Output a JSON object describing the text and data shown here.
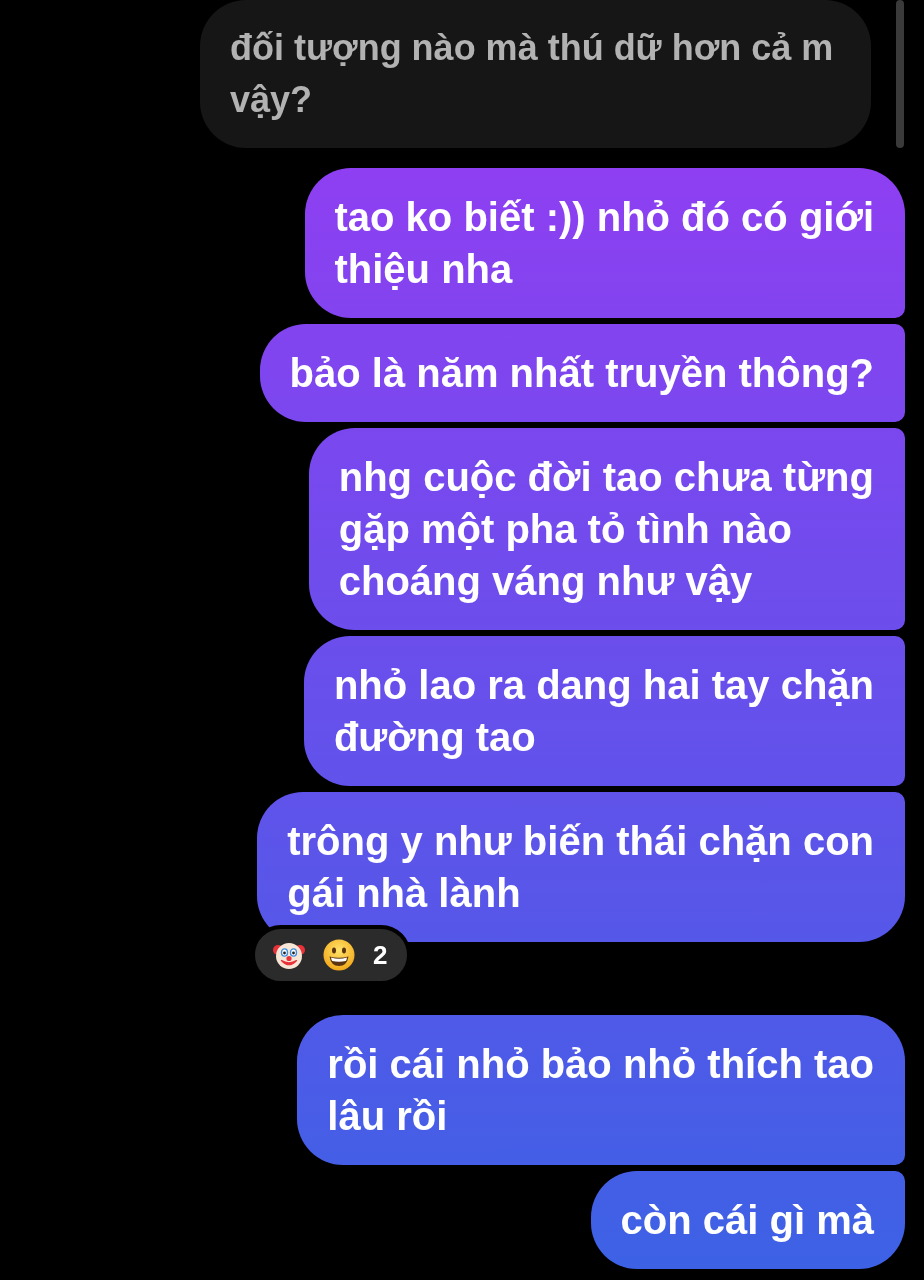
{
  "messages": [
    {
      "kind": "received",
      "text": "đối tượng nào mà thú dữ hơn cả m\nvậy?"
    },
    {
      "kind": "sent",
      "text": "tao ko biết :)) nhỏ đó có giới\nthiệu nha"
    },
    {
      "kind": "sent",
      "text": "bảo là năm nhất truyền thông?"
    },
    {
      "kind": "sent",
      "text": "nhg cuộc đời tao chưa từng\ngặp một pha tỏ tình nào\nchoáng váng như vậy"
    },
    {
      "kind": "sent",
      "text": "nhỏ lao ra dang hai tay chặn\nđường tao"
    },
    {
      "kind": "sent",
      "text": "trông y như biến thái chặn con\ngái nhà lành",
      "reaction": {
        "count": "2"
      }
    },
    {
      "kind": "sent",
      "text": "rồi cái nhỏ bảo nhỏ thích tao\nlâu rồi"
    },
    {
      "kind": "sent",
      "text": "còn cái gì mà"
    }
  ]
}
